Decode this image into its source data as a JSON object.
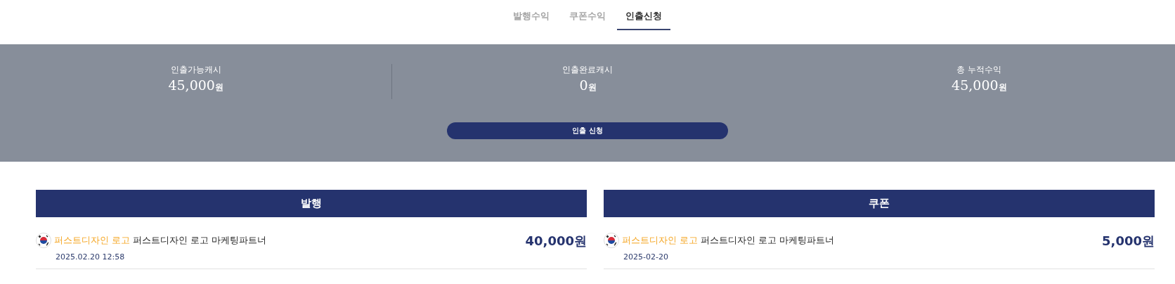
{
  "tabs": [
    {
      "label": "발행수익",
      "selected": false
    },
    {
      "label": "쿠폰수익",
      "selected": false
    },
    {
      "label": "인출신청",
      "selected": true
    }
  ],
  "stats": [
    {
      "label": "인출가능캐시",
      "value": "45,000",
      "unit": "원"
    },
    {
      "label": "인출완료캐시",
      "value": "0",
      "unit": "원"
    },
    {
      "label": "총 누적수익",
      "value": "45,000",
      "unit": "원"
    }
  ],
  "withdraw_button": "인출 신청",
  "sections": [
    {
      "title": "발행",
      "items": [
        {
          "brand": "퍼스트디자인 로고",
          "title": "퍼스트디자인 로고 마케팅파트너",
          "date": "2025.02.20 12:58",
          "amount": "40,000원"
        }
      ]
    },
    {
      "title": "쿠폰",
      "items": [
        {
          "brand": "퍼스트디자인 로고",
          "title": "퍼스트디자인 로고 마케팅파트너",
          "date": "2025-02-20",
          "amount": "5,000원"
        }
      ]
    }
  ]
}
